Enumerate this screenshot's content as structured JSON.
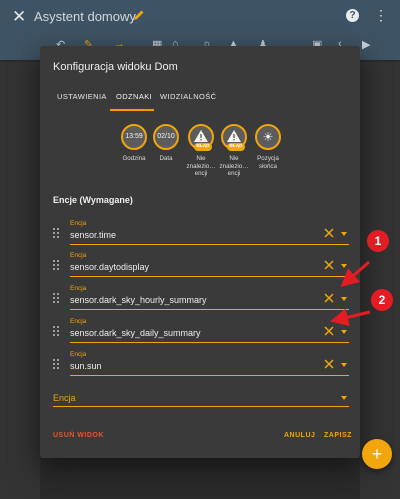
{
  "app_bar": {
    "title": "Asystent domowy",
    "help_label": "?",
    "menu_label": "⋮"
  },
  "dialog": {
    "title": "Konfiguracja widoku Dom",
    "tabs": [
      {
        "label": "USTAWIENIA"
      },
      {
        "label": "ODZNAKI"
      },
      {
        "label": "WIDZIALNOŚĆ"
      }
    ],
    "active_tab": "ODZNAKI",
    "badges": [
      {
        "value": "13:59",
        "label": "Godzina"
      },
      {
        "value": "02/10",
        "label": "Data"
      },
      {
        "value": "!",
        "pill": "BŁĄD",
        "label": "Nie znalezio… encji"
      },
      {
        "value": "!",
        "pill": "BŁĄD",
        "label": "Nie znalezio… encji"
      },
      {
        "value": "☀",
        "label": "Pozycja słońca"
      }
    ],
    "section_title": "Encje (Wymagane)",
    "entities": [
      {
        "label": "Encja",
        "value": "sensor.time"
      },
      {
        "label": "Encja",
        "value": "sensor.daytodisplay"
      },
      {
        "label": "Encja",
        "value": "sensor.dark_sky_hourly_summary"
      },
      {
        "label": "Encja",
        "value": "sensor.dark_sky_daily_summary"
      },
      {
        "label": "Encja",
        "value": "sun.sun"
      }
    ],
    "add_entity_label": "Encja",
    "buttons": {
      "delete": "USUŃ WIDOK",
      "cancel": "ANULUJ",
      "save": "ZAPISZ"
    }
  },
  "annotations": [
    {
      "number": "1"
    },
    {
      "number": "2"
    }
  ],
  "fab": {
    "label": "+"
  },
  "colors": {
    "app_bar": "#3e5364",
    "accent": "#f0a60c",
    "danger": "#e4572e",
    "dialog_bg": "#3a3a3a",
    "annotation": "#e51c23"
  }
}
